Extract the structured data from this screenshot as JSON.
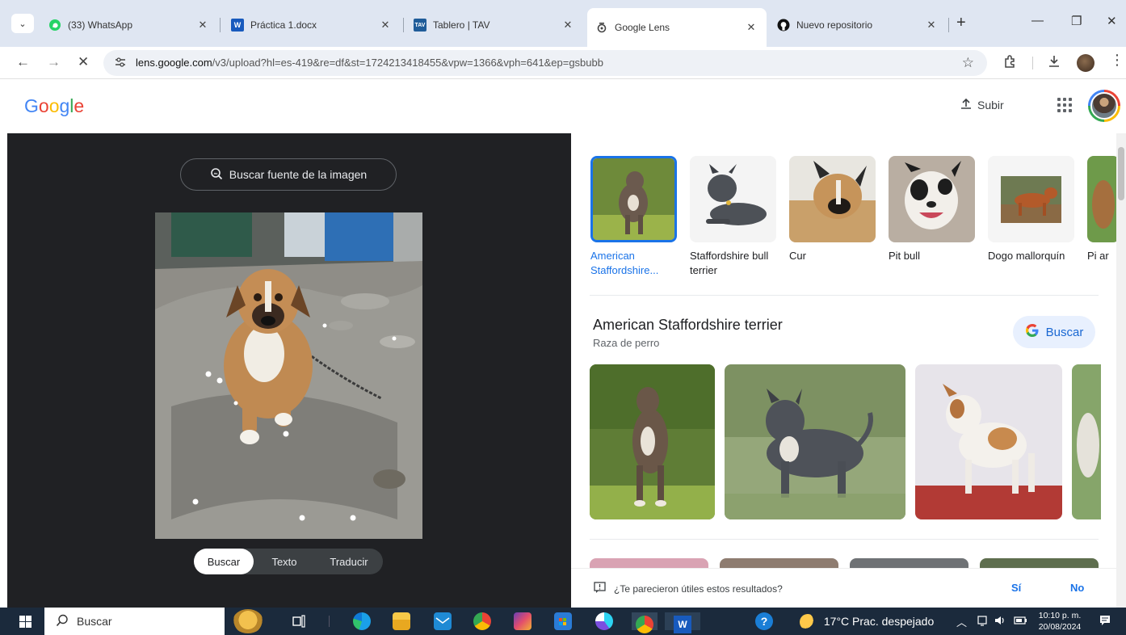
{
  "browser": {
    "tabs": [
      {
        "title": "(33) WhatsApp",
        "icon": "whatsapp-icon",
        "color": "#25d366"
      },
      {
        "title": "Práctica 1.docx",
        "icon": "word-icon",
        "color": "#185abd"
      },
      {
        "title": "Tablero | TAV",
        "icon": "tav-icon",
        "color": "#1f5c99"
      },
      {
        "title": "Google Lens",
        "icon": "lens-icon",
        "active": true
      },
      {
        "title": "Nuevo repositorio",
        "icon": "github-icon"
      }
    ],
    "url_host": "lens.google.com",
    "url_path": "/v3/upload?hl=es-419&re=df&st=1724213418455&vpw=1366&vph=641&ep=gsbubb"
  },
  "header": {
    "logo": "Google",
    "upload_label": "Subir"
  },
  "lens": {
    "source_button": "Buscar fuente de la imagen",
    "modes": [
      "Buscar",
      "Texto",
      "Traducir"
    ],
    "selected_mode": "Buscar"
  },
  "results": {
    "candidates": [
      {
        "label": "American Staffordshire...",
        "selected": true
      },
      {
        "label": "Staffordshire bull terrier"
      },
      {
        "label": "Cur"
      },
      {
        "label": "Pit bull"
      },
      {
        "label": "Dogo mallorquín"
      },
      {
        "label": "Pi ar"
      }
    ],
    "breed_title": "American Staffordshire terrier",
    "breed_subtitle": "Raza de perro",
    "search_button": "Buscar",
    "feedback_question": "¿Te parecieron útiles estos resultados?",
    "feedback_yes": "Sí",
    "feedback_no": "No"
  },
  "taskbar": {
    "search_label": "Buscar",
    "weather": "17°C  Prac. despejado",
    "time": "10:10 p. m.",
    "date": "20/08/2024"
  },
  "colors": {
    "accent": "#1a73e8",
    "dark_pane": "#202124",
    "taskbar": "#1b2a3c"
  }
}
